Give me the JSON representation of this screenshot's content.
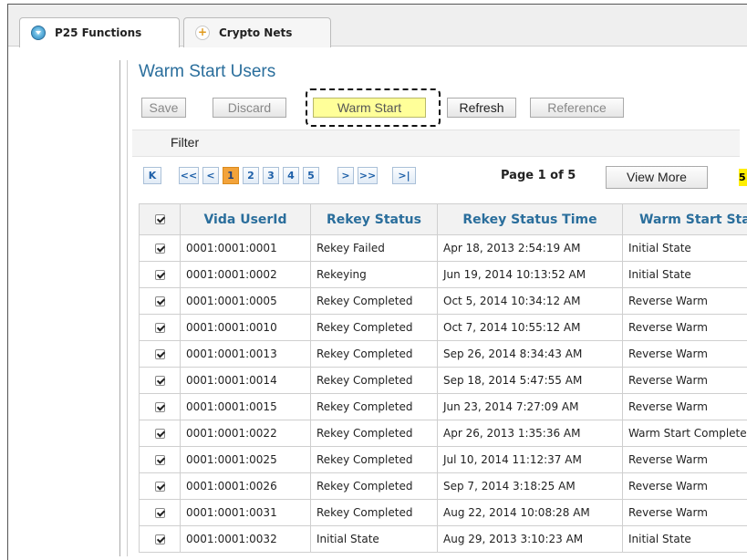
{
  "tabs": [
    {
      "label": "P25 Functions",
      "icon": "p25-icon",
      "active": true
    },
    {
      "label": "Crypto Nets",
      "icon": "plus-icon",
      "active": false
    }
  ],
  "page_title": "Warm Start Users",
  "toolbar": {
    "save": "Save",
    "discard": "Discard",
    "warm_start": "Warm Start",
    "refresh": "Refresh",
    "reference": "Reference"
  },
  "filter_label": "Filter",
  "pagination": {
    "first": "K",
    "prev_group": "<<",
    "prev": "<",
    "pages": [
      "1",
      "2",
      "3",
      "4",
      "5"
    ],
    "current_page": 1,
    "next": ">",
    "next_group": ">>",
    "last": ">|",
    "status": "Page 1 of 5",
    "view_more": "View More",
    "badge": "5"
  },
  "table": {
    "columns": [
      "Vida UserId",
      "Rekey Status",
      "Rekey Status Time",
      "Warm Start Status"
    ],
    "rows": [
      {
        "id": "0001:0001:0001",
        "status": "Rekey Failed",
        "time": "Apr 18, 2013 2:54:19 AM",
        "warm": "Initial State"
      },
      {
        "id": "0001:0001:0002",
        "status": "Rekeying",
        "time": "Jun 19, 2014 10:13:52 AM",
        "warm": "Initial State"
      },
      {
        "id": "0001:0001:0005",
        "status": "Rekey Completed",
        "time": "Oct 5, 2014 10:34:12 AM",
        "warm": "Reverse Warm"
      },
      {
        "id": "0001:0001:0010",
        "status": "Rekey Completed",
        "time": "Oct 7, 2014 10:55:12 AM",
        "warm": "Reverse Warm"
      },
      {
        "id": "0001:0001:0013",
        "status": "Rekey Completed",
        "time": "Sep 26, 2014 8:34:43 AM",
        "warm": "Reverse Warm"
      },
      {
        "id": "0001:0001:0014",
        "status": "Rekey Completed",
        "time": "Sep 18, 2014 5:47:55 AM",
        "warm": "Reverse Warm"
      },
      {
        "id": "0001:0001:0015",
        "status": "Rekey Completed",
        "time": "Jun 23, 2014 7:27:09 AM",
        "warm": "Reverse Warm"
      },
      {
        "id": "0001:0001:0022",
        "status": "Rekey Completed",
        "time": "Apr 26, 2013 1:35:36 AM",
        "warm": "Warm Start Completed"
      },
      {
        "id": "0001:0001:0025",
        "status": "Rekey Completed",
        "time": "Jul 10, 2014 11:12:37 AM",
        "warm": "Reverse Warm"
      },
      {
        "id": "0001:0001:0026",
        "status": "Rekey Completed",
        "time": "Sep 7, 2014 3:18:25 AM",
        "warm": "Reverse Warm"
      },
      {
        "id": "0001:0001:0031",
        "status": "Rekey Completed",
        "time": "Aug 22, 2014 10:08:28 AM",
        "warm": "Reverse Warm"
      },
      {
        "id": "0001:0001:0032",
        "status": "Initial State",
        "time": "Aug 29, 2013 3:10:23 AM",
        "warm": "Initial State"
      }
    ]
  },
  "colors": {
    "accent": "#2a6e9c",
    "highlight": "#ffff99",
    "current_page": "#f3a33a"
  }
}
